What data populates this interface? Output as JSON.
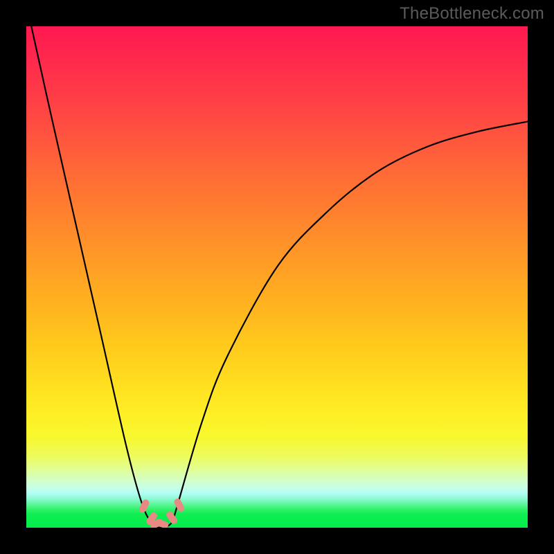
{
  "watermark": "TheBottleneck.com",
  "chart_data": {
    "type": "line",
    "title": "",
    "xlabel": "",
    "ylabel": "",
    "xlim": [
      0,
      100
    ],
    "ylim": [
      0,
      100
    ],
    "series": [
      {
        "name": "bottleneck-curve",
        "x": [
          1,
          5,
          10,
          15,
          20,
          23,
          25,
          27,
          29,
          30,
          35,
          40,
          50,
          60,
          70,
          80,
          90,
          100
        ],
        "values": [
          100,
          82,
          60,
          38,
          16,
          5,
          1,
          0,
          1,
          4,
          21,
          34,
          52,
          63,
          71,
          76,
          79,
          81
        ]
      }
    ],
    "markers": {
      "name": "highlight-dots",
      "color": "#e88a84",
      "x": [
        23.5,
        25.0,
        26.0,
        27.0,
        29.0,
        30.5
      ],
      "values": [
        4.3,
        1.8,
        0.8,
        0.8,
        2.0,
        4.5
      ]
    },
    "background_gradient": {
      "top": "#ff1850",
      "mid": "#ffee25",
      "bottom": "#03ed4c"
    }
  }
}
